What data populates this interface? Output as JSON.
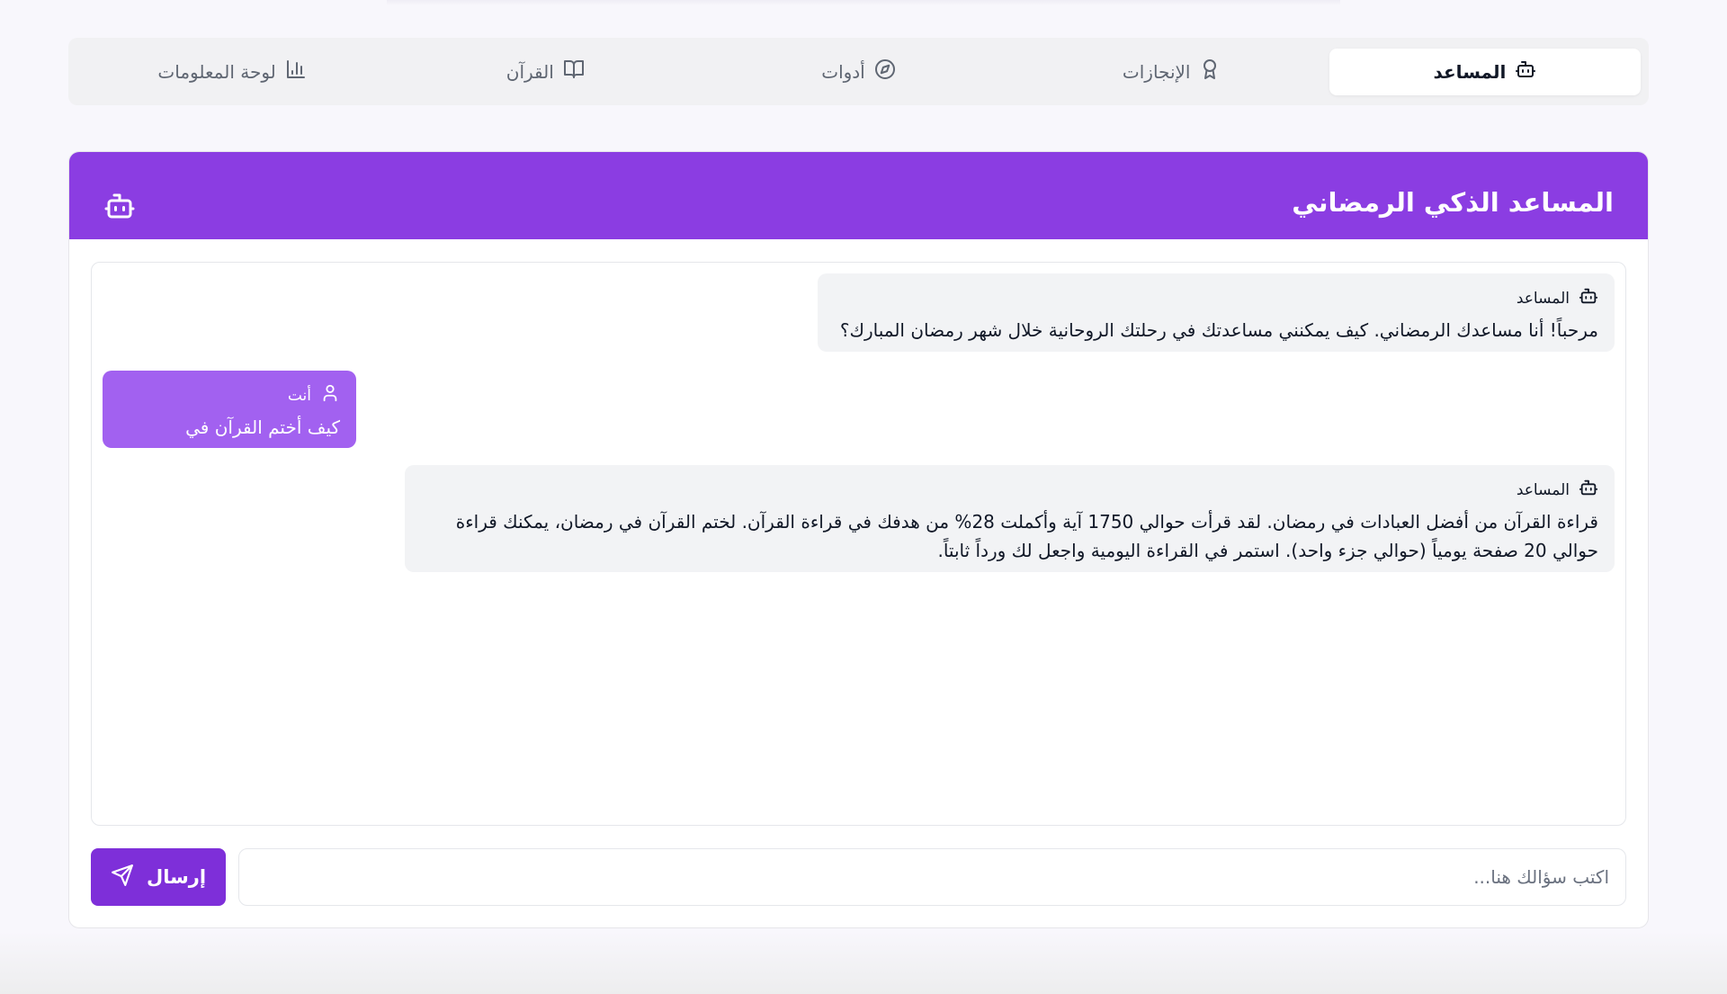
{
  "tabs": [
    {
      "label": "المساعد",
      "icon": "bot-icon",
      "active": true
    },
    {
      "label": "الإنجازات",
      "icon": "award-icon",
      "active": false
    },
    {
      "label": "أدوات",
      "icon": "compass-icon",
      "active": false
    },
    {
      "label": "القرآن",
      "icon": "book-open-icon",
      "active": false
    },
    {
      "label": "لوحة المعلومات",
      "icon": "bar-chart-icon",
      "active": false
    }
  ],
  "card": {
    "title": "المساعد الذكي الرمضاني",
    "header_color": "#8b3de2"
  },
  "messages": [
    {
      "sender": "المساعد",
      "role": "bot",
      "icon": "bot-icon",
      "lines": [
        "مرحباً! أنا مساعدك الرمضاني. كيف يمكنني مساعدتك في رحلتك الروحانية خلال شهر رمضان المبارك؟"
      ]
    },
    {
      "sender": "أنت",
      "role": "user",
      "icon": "user-icon",
      "lines": [
        "كيف أختم القرآن في رمضان؟"
      ]
    },
    {
      "sender": "المساعد",
      "role": "bot",
      "icon": "bot-icon",
      "lines": [
        "قراءة القرآن من أفضل العبادات في رمضان. لقد قرأت حوالي 1750 آية وأكملت 28% من هدفك في قراءة القرآن. لختم القرآن في رمضان، يمكنك قراءة",
        "حوالي 20 صفحة يومياً (حوالي جزء واحد). استمر في القراءة اليومية واجعل لك ورداً ثابتاً."
      ]
    }
  ],
  "input": {
    "placeholder": "اكتب سؤالك هنا...",
    "value": ""
  },
  "send_button": {
    "label": "إرسال",
    "icon": "send-icon",
    "color": "#7e2fd9"
  },
  "colors": {
    "accent": "#8b3de2",
    "user_bubble": "#a261f0",
    "bot_bubble": "#f2f3f5"
  }
}
